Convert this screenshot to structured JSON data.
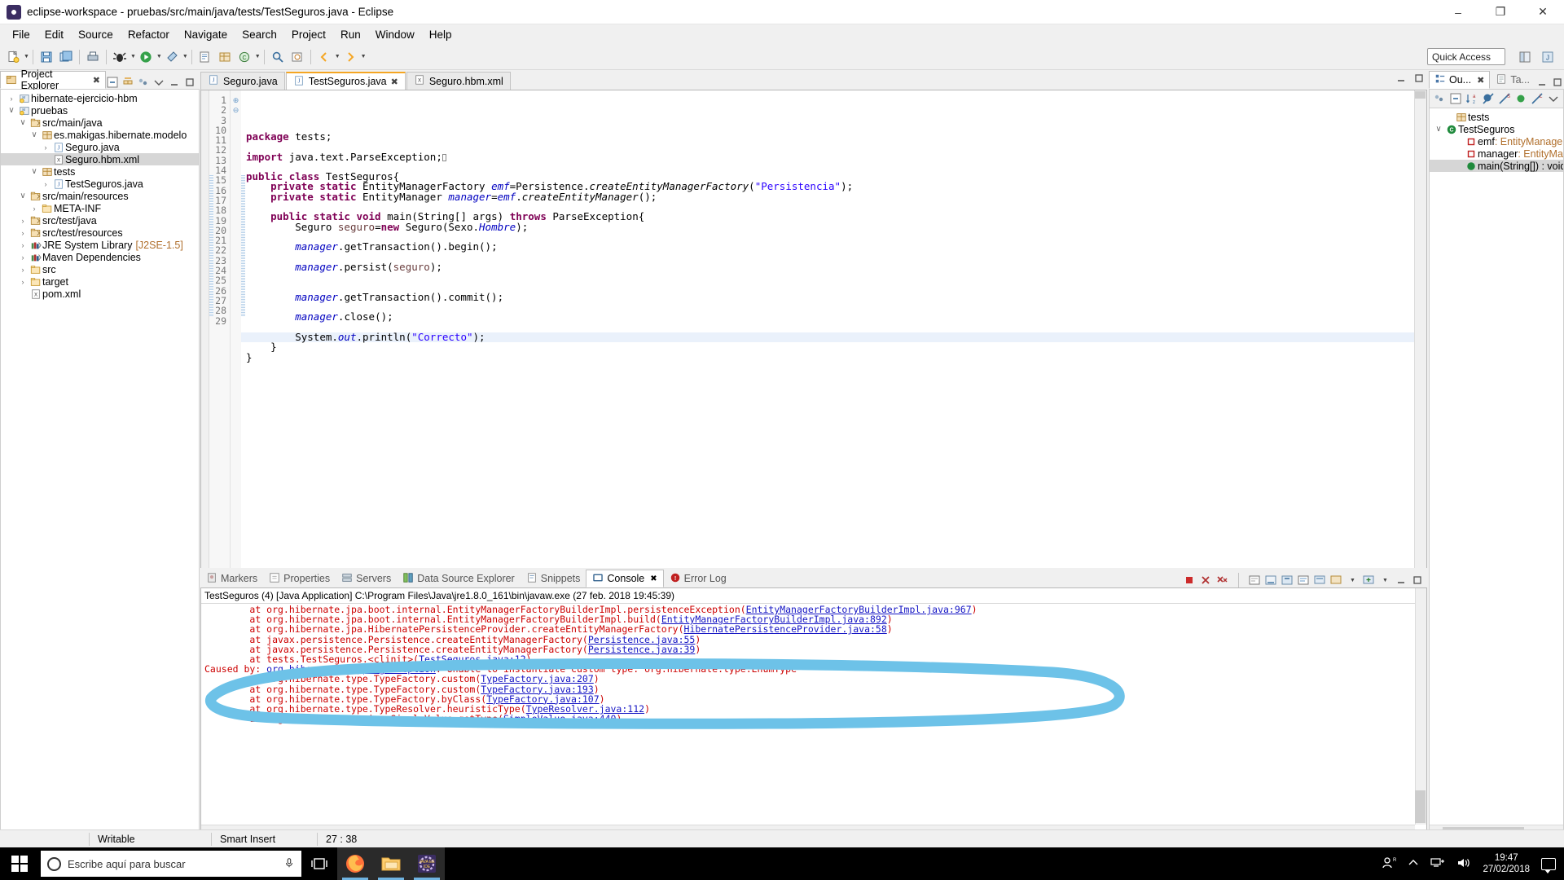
{
  "window": {
    "title": "eclipse-workspace - pruebas/src/main/java/tests/TestSeguros.java - Eclipse",
    "app_icon": "eclipse-icon",
    "minimize": "–",
    "maximize": "❐",
    "close": "✕"
  },
  "menu": {
    "items": [
      "File",
      "Edit",
      "Source",
      "Refactor",
      "Navigate",
      "Search",
      "Project",
      "Run",
      "Window",
      "Help"
    ]
  },
  "toolbar": {
    "quick_access_placeholder": "Quick Access",
    "quick_access_value": "Quick Access"
  },
  "explorer": {
    "tab_label": "Project Explorer",
    "tab_close": "✖",
    "tree": [
      {
        "indent": 0,
        "arrow": "›",
        "icon": "java-project-icon",
        "label": "hibernate-ejercicio-hbm",
        "selected": false
      },
      {
        "indent": 0,
        "arrow": "∨",
        "icon": "java-project-icon",
        "label": "pruebas",
        "selected": false
      },
      {
        "indent": 1,
        "arrow": "∨",
        "icon": "source-folder-icon",
        "label": "src/main/java",
        "selected": false
      },
      {
        "indent": 2,
        "arrow": "∨",
        "icon": "package-icon",
        "label": "es.makigas.hibernate.modelo",
        "selected": false
      },
      {
        "indent": 3,
        "arrow": "›",
        "icon": "java-file-icon",
        "label": "Seguro.java",
        "selected": false
      },
      {
        "indent": 3,
        "arrow": "",
        "icon": "xml-file-icon",
        "label": "Seguro.hbm.xml",
        "selected": true
      },
      {
        "indent": 2,
        "arrow": "∨",
        "icon": "package-icon",
        "label": "tests",
        "selected": false
      },
      {
        "indent": 3,
        "arrow": "›",
        "icon": "java-file-icon",
        "label": "TestSeguros.java",
        "selected": false
      },
      {
        "indent": 1,
        "arrow": "∨",
        "icon": "source-folder-icon",
        "label": "src/main/resources",
        "selected": false
      },
      {
        "indent": 2,
        "arrow": "›",
        "icon": "folder-icon",
        "label": "META-INF",
        "selected": false
      },
      {
        "indent": 1,
        "arrow": "›",
        "icon": "source-folder-icon",
        "label": "src/test/java",
        "selected": false
      },
      {
        "indent": 1,
        "arrow": "›",
        "icon": "source-folder-icon",
        "label": "src/test/resources",
        "selected": false
      },
      {
        "indent": 1,
        "arrow": "›",
        "icon": "library-icon",
        "label": "JRE System Library",
        "suffix": "[J2SE-1.5]",
        "selected": false
      },
      {
        "indent": 1,
        "arrow": "›",
        "icon": "library-icon",
        "label": "Maven Dependencies",
        "selected": false
      },
      {
        "indent": 1,
        "arrow": "›",
        "icon": "folder-icon",
        "label": "src",
        "selected": false
      },
      {
        "indent": 1,
        "arrow": "›",
        "icon": "folder-icon",
        "label": "target",
        "selected": false
      },
      {
        "indent": 1,
        "arrow": "",
        "icon": "xml-file-icon",
        "label": "pom.xml",
        "selected": false
      }
    ]
  },
  "editor": {
    "tabs": [
      {
        "label": "Seguro.java",
        "icon": "java-file-icon",
        "active": false,
        "closeable": false
      },
      {
        "label": "TestSeguros.java",
        "icon": "java-file-icon",
        "active": true,
        "closeable": true,
        "close": "✖"
      },
      {
        "label": "Seguro.hbm.xml",
        "icon": "xml-file-icon",
        "active": false,
        "closeable": false
      }
    ],
    "line_numbers": [
      "1",
      "2",
      "3",
      "10",
      "11",
      "12",
      "13",
      "14",
      "15",
      "16",
      "17",
      "18",
      "19",
      "20",
      "21",
      "22",
      "23",
      "24",
      "25",
      "26",
      "27",
      "28",
      "29"
    ],
    "code_lines": [
      {
        "num": "1",
        "text": "package tests;"
      },
      {
        "num": "2",
        "text": ""
      },
      {
        "num": "3",
        "text": "import java.text.ParseException;",
        "fold": "⊕"
      },
      {
        "num": "10",
        "text": ""
      },
      {
        "num": "11",
        "text": "public class TestSeguros{"
      },
      {
        "num": "12",
        "text": "    private static EntityManagerFactory emf=Persistence.createEntityManagerFactory(\"Persistencia\");"
      },
      {
        "num": "13",
        "text": "    private static EntityManager manager=emf.createEntityManager();"
      },
      {
        "num": "14",
        "text": ""
      },
      {
        "num": "15",
        "text": "    public static void main(String[] args) throws ParseException{",
        "fold": "⊖"
      },
      {
        "num": "16",
        "text": "        Seguro seguro=new Seguro(Sexo.Hombre);"
      },
      {
        "num": "17",
        "text": ""
      },
      {
        "num": "18",
        "text": "        manager.getTransaction().begin();"
      },
      {
        "num": "19",
        "text": ""
      },
      {
        "num": "20",
        "text": "        manager.persist(seguro);"
      },
      {
        "num": "21",
        "text": ""
      },
      {
        "num": "22",
        "text": ""
      },
      {
        "num": "23",
        "text": "        manager.getTransaction().commit();"
      },
      {
        "num": "24",
        "text": ""
      },
      {
        "num": "25",
        "text": "        manager.close();"
      },
      {
        "num": "26",
        "text": ""
      },
      {
        "num": "27",
        "text": "        System.out.println(\"Correcto\");",
        "highlighted": true
      },
      {
        "num": "28",
        "text": "    }"
      },
      {
        "num": "29",
        "text": "}"
      }
    ]
  },
  "outline": {
    "tabs": [
      {
        "label": "Ou...",
        "icon": "outline-icon",
        "active": true,
        "close": "✖"
      },
      {
        "label": "Ta...",
        "icon": "task-icon",
        "active": false
      }
    ],
    "rows": [
      {
        "indent": 1,
        "arrow": "",
        "icon": "package-icon",
        "label": "tests",
        "type": "",
        "selected": false
      },
      {
        "indent": 0,
        "arrow": "∨",
        "icon": "class-icon",
        "label": "TestSeguros",
        "type": "",
        "selected": false
      },
      {
        "indent": 2,
        "arrow": "",
        "icon": "private-field-icon",
        "label": "emf",
        "type": " : EntityManager",
        "selected": false
      },
      {
        "indent": 2,
        "arrow": "",
        "icon": "private-field-icon",
        "label": "manager",
        "type": " : EntityMa",
        "selected": false
      },
      {
        "indent": 2,
        "arrow": "",
        "icon": "public-method-icon",
        "label": "main(String[]) : void",
        "type": "",
        "selected": true
      }
    ]
  },
  "console": {
    "tabs": [
      {
        "label": "Markers",
        "icon": "markers-icon",
        "active": false
      },
      {
        "label": "Properties",
        "icon": "properties-icon",
        "active": false
      },
      {
        "label": "Servers",
        "icon": "servers-icon",
        "active": false
      },
      {
        "label": "Data Source Explorer",
        "icon": "data-source-icon",
        "active": false
      },
      {
        "label": "Snippets",
        "icon": "snippets-icon",
        "active": false
      },
      {
        "label": "Console",
        "icon": "console-icon",
        "active": true,
        "close": "✖"
      },
      {
        "label": "Error Log",
        "icon": "error-log-icon",
        "active": false
      }
    ],
    "header": "TestSeguros (4) [Java Application] C:\\Program Files\\Java\\jre1.8.0_161\\bin\\javaw.exe (27 feb. 2018 19:45:39)",
    "lines": [
      {
        "prefix": "\tat org.hibernate.jpa.boot.internal.EntityManagerFactoryBuilderImpl.persistenceException(",
        "link": "EntityManagerFactoryBuilderImpl.java:967",
        "suffix": ")"
      },
      {
        "prefix": "\tat org.hibernate.jpa.boot.internal.EntityManagerFactoryBuilderImpl.build(",
        "link": "EntityManagerFactoryBuilderImpl.java:892",
        "suffix": ")"
      },
      {
        "prefix": "\tat org.hibernate.jpa.HibernatePersistenceProvider.createEntityManagerFactory(",
        "link": "HibernatePersistenceProvider.java:58",
        "suffix": ")"
      },
      {
        "prefix": "\tat javax.persistence.Persistence.createEntityManagerFactory(",
        "link": "Persistence.java:55",
        "suffix": ")"
      },
      {
        "prefix": "\tat javax.persistence.Persistence.createEntityManagerFactory(",
        "link": "Persistence.java:39",
        "suffix": ")"
      },
      {
        "prefix": "\tat tests.TestSeguros.<clinit>(",
        "link": "TestSeguros.java:12",
        "suffix": ")"
      },
      {
        "prefix": "Caused by: ",
        "link": "org.hibernate.MappingException",
        "suffix": ": Unable to instantiate custom type: org.hibernate.type.EnumType"
      },
      {
        "prefix": "\tat org.hibernate.type.TypeFactory.custom(",
        "link": "TypeFactory.java:207",
        "suffix": ")"
      },
      {
        "prefix": "\tat org.hibernate.type.TypeFactory.custom(",
        "link": "TypeFactory.java:193",
        "suffix": ")"
      },
      {
        "prefix": "\tat org.hibernate.type.TypeFactory.byClass(",
        "link": "TypeFactory.java:107",
        "suffix": ")"
      },
      {
        "prefix": "\tat org.hibernate.type.TypeResolver.heuristicType(",
        "link": "TypeResolver.java:112",
        "suffix": ")"
      },
      {
        "prefix": "\tat org.hibernate.mapping.SimpleValue.getType(",
        "link": "SimpleValue.java:440",
        "suffix": ")"
      }
    ],
    "annotation_color": "#6dc2e8"
  },
  "statusbar": {
    "writable": "Writable",
    "insert_mode": "Smart Insert",
    "position": "27 : 38"
  },
  "taskbar": {
    "search_placeholder": "Escribe aquí para buscar",
    "apps": [
      {
        "name": "task-view-icon",
        "active": false
      },
      {
        "name": "firefox-icon",
        "active": true
      },
      {
        "name": "file-explorer-icon",
        "active": true
      },
      {
        "name": "eclipse-icon",
        "active": true
      }
    ],
    "clock_time": "19:47",
    "clock_date": "27/02/2018"
  }
}
